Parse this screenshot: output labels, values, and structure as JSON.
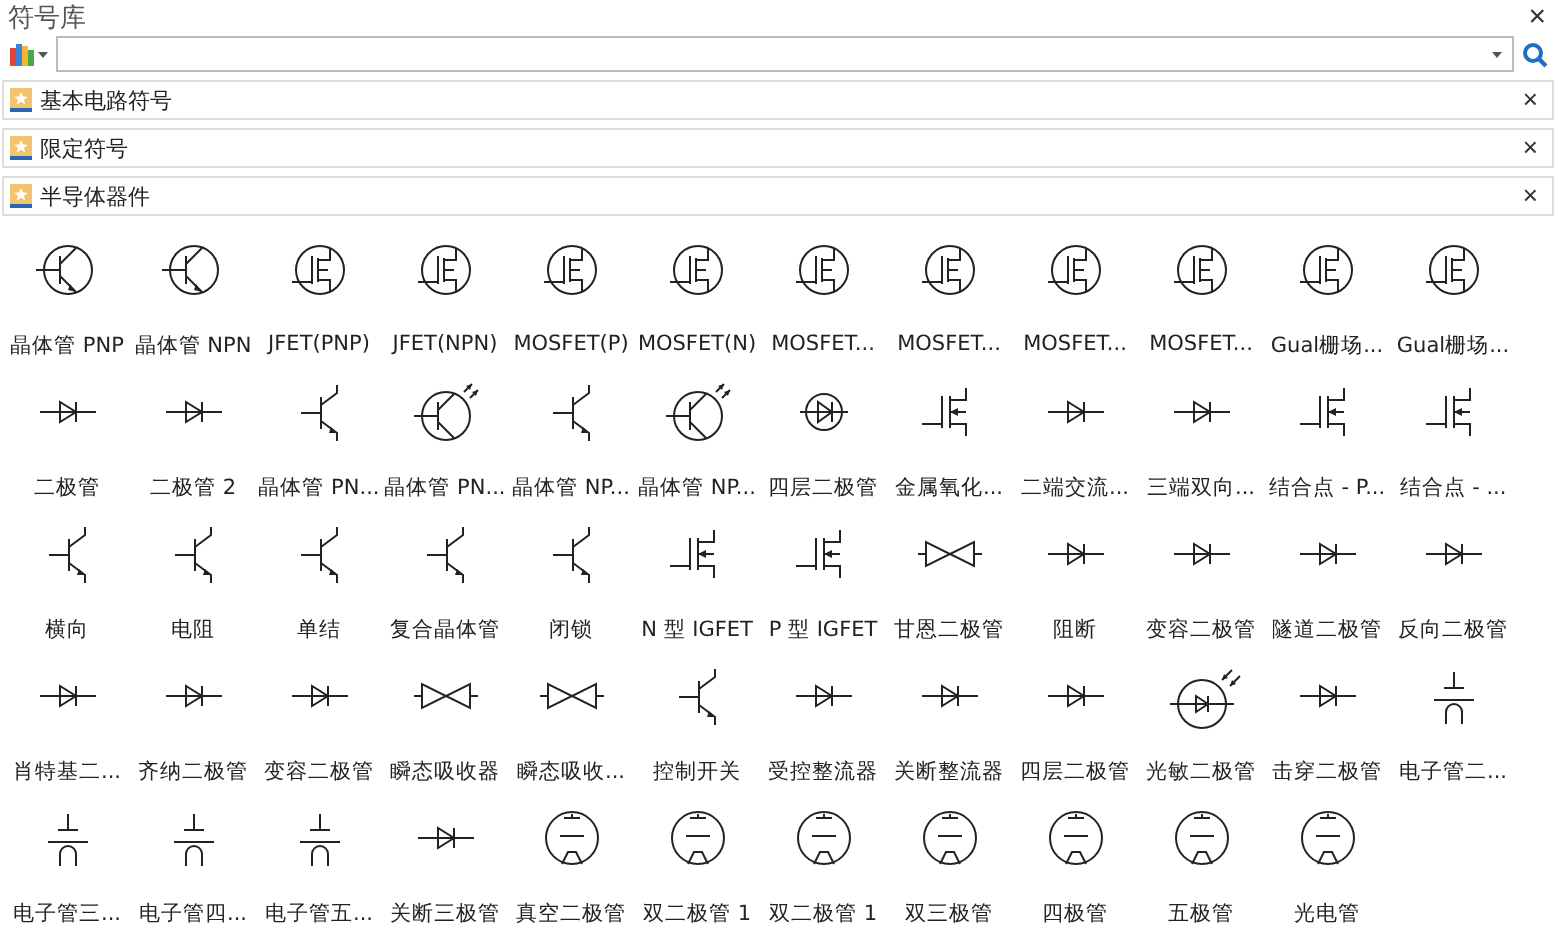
{
  "panel": {
    "title": "符号库",
    "close": "×"
  },
  "categories": [
    {
      "label": "基本电路符号",
      "close": "×"
    },
    {
      "label": "限定符号",
      "close": "×"
    },
    {
      "label": "半导体器件",
      "close": "×"
    }
  ],
  "symbols": [
    {
      "label": "晶体管 PNP",
      "kind": "circle-bjt"
    },
    {
      "label": "晶体管 NPN",
      "kind": "circle-bjt"
    },
    {
      "label": "JFET(PNP)",
      "kind": "circle-fet"
    },
    {
      "label": "JFET(NPN)",
      "kind": "circle-fet"
    },
    {
      "label": "MOSFET(P)",
      "kind": "circle-fet"
    },
    {
      "label": "MOSFET(N)",
      "kind": "circle-fet"
    },
    {
      "label": "MOSFET...",
      "kind": "circle-fet"
    },
    {
      "label": "MOSFET...",
      "kind": "circle-fet"
    },
    {
      "label": "MOSFET...",
      "kind": "circle-fet"
    },
    {
      "label": "MOSFET...",
      "kind": "circle-fet"
    },
    {
      "label": "Gual栅场...",
      "kind": "circle-fet"
    },
    {
      "label": "Gual栅场...",
      "kind": "circle-fet"
    },
    {
      "label": "二极管",
      "kind": "diode"
    },
    {
      "label": "二极管 2",
      "kind": "diode"
    },
    {
      "label": "晶体管 PN...",
      "kind": "bjt"
    },
    {
      "label": "晶体管 PN...",
      "kind": "circle-bjt-light"
    },
    {
      "label": "晶体管 NP...",
      "kind": "bjt"
    },
    {
      "label": "晶体管 NP...",
      "kind": "circle-bjt-light"
    },
    {
      "label": "四层二极管",
      "kind": "ring-diode"
    },
    {
      "label": "金属氧化...",
      "kind": "fet"
    },
    {
      "label": "二端交流...",
      "kind": "diode"
    },
    {
      "label": "三端双向...",
      "kind": "diode"
    },
    {
      "label": "结合点 - P...",
      "kind": "fet"
    },
    {
      "label": "结合点 - ...",
      "kind": "fet"
    },
    {
      "label": "横向",
      "kind": "bjt"
    },
    {
      "label": "电阻",
      "kind": "bjt"
    },
    {
      "label": "单结",
      "kind": "bjt"
    },
    {
      "label": "复合晶体管",
      "kind": "bjt"
    },
    {
      "label": "闭锁",
      "kind": "bjt"
    },
    {
      "label": "N 型 IGFET",
      "kind": "fet"
    },
    {
      "label": "P 型 IGFET",
      "kind": "fet"
    },
    {
      "label": "甘恩二极管",
      "kind": "diode-pair"
    },
    {
      "label": "阻断",
      "kind": "diode"
    },
    {
      "label": "变容二极管",
      "kind": "diode"
    },
    {
      "label": "隧道二极管",
      "kind": "diode"
    },
    {
      "label": "反向二极管",
      "kind": "diode"
    },
    {
      "label": "肖特基二...",
      "kind": "diode"
    },
    {
      "label": "齐纳二极管",
      "kind": "diode"
    },
    {
      "label": "变容二极管",
      "kind": "diode"
    },
    {
      "label": "瞬态吸收器",
      "kind": "diode-pair"
    },
    {
      "label": "瞬态吸收...",
      "kind": "diode-pair"
    },
    {
      "label": "控制开关",
      "kind": "bjt"
    },
    {
      "label": "受控整流器",
      "kind": "diode"
    },
    {
      "label": "关断整流器",
      "kind": "diode"
    },
    {
      "label": "四层二极管",
      "kind": "diode"
    },
    {
      "label": "光敏二极管",
      "kind": "photo-diode"
    },
    {
      "label": "击穿二极管",
      "kind": "diode"
    },
    {
      "label": "电子管二...",
      "kind": "electrode"
    },
    {
      "label": "电子管三...",
      "kind": "electrode"
    },
    {
      "label": "电子管四...",
      "kind": "electrode"
    },
    {
      "label": "电子管五...",
      "kind": "electrode"
    },
    {
      "label": "关断三极管",
      "kind": "diode"
    },
    {
      "label": "真空二极管",
      "kind": "tube"
    },
    {
      "label": "双二极管 1",
      "kind": "tube"
    },
    {
      "label": "双二极管 1",
      "kind": "tube"
    },
    {
      "label": "双三极管",
      "kind": "tube"
    },
    {
      "label": "四极管",
      "kind": "tube"
    },
    {
      "label": "五极管",
      "kind": "tube"
    },
    {
      "label": "光电管",
      "kind": "tube"
    }
  ]
}
